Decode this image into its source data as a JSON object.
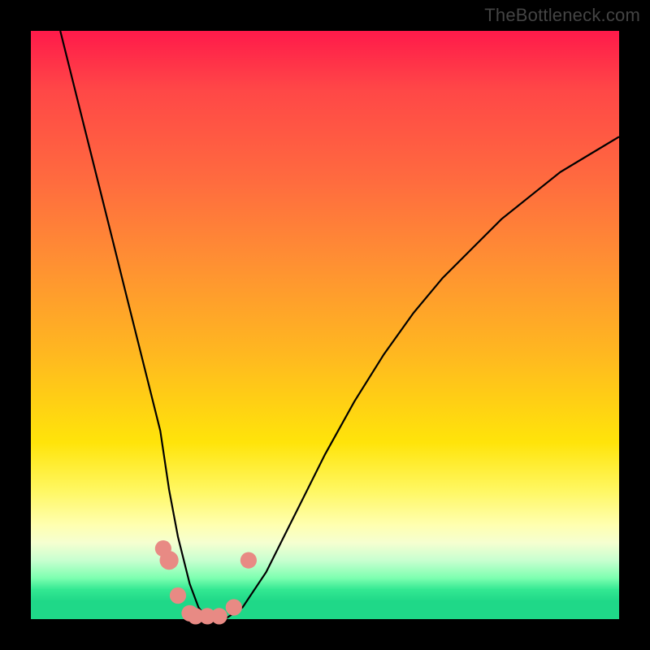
{
  "watermark": "TheBottleneck.com",
  "chart_data": {
    "type": "line",
    "title": "",
    "xlabel": "",
    "ylabel": "",
    "xlim": [
      0,
      100
    ],
    "ylim": [
      0,
      100
    ],
    "series": [
      {
        "name": "bottleneck-curve",
        "x": [
          5,
          8,
          10,
          12,
          14,
          16,
          18,
          20,
          22,
          23.5,
          25,
          27,
          28.5,
          30,
          33,
          36,
          40,
          45,
          50,
          55,
          60,
          65,
          70,
          75,
          80,
          85,
          90,
          95,
          100
        ],
        "values": [
          100,
          88,
          80,
          72,
          64,
          56,
          48,
          40,
          32,
          22,
          14,
          6,
          2,
          0,
          0,
          2,
          8,
          18,
          28,
          37,
          45,
          52,
          58,
          63,
          68,
          72,
          76,
          79,
          82
        ]
      }
    ],
    "markers": [
      {
        "x": 22.5,
        "y": 12,
        "r": 1.4
      },
      {
        "x": 23.5,
        "y": 10,
        "r": 1.6
      },
      {
        "x": 25.0,
        "y": 4,
        "r": 1.4
      },
      {
        "x": 27.0,
        "y": 1,
        "r": 1.4
      },
      {
        "x": 28.0,
        "y": 0.5,
        "r": 1.4
      },
      {
        "x": 30.0,
        "y": 0.5,
        "r": 1.4
      },
      {
        "x": 32.0,
        "y": 0.5,
        "r": 1.4
      },
      {
        "x": 34.5,
        "y": 2,
        "r": 1.4
      },
      {
        "x": 37.0,
        "y": 10,
        "r": 1.4
      }
    ],
    "colors": {
      "curve": "#000000",
      "marker": "#e88a84"
    }
  }
}
